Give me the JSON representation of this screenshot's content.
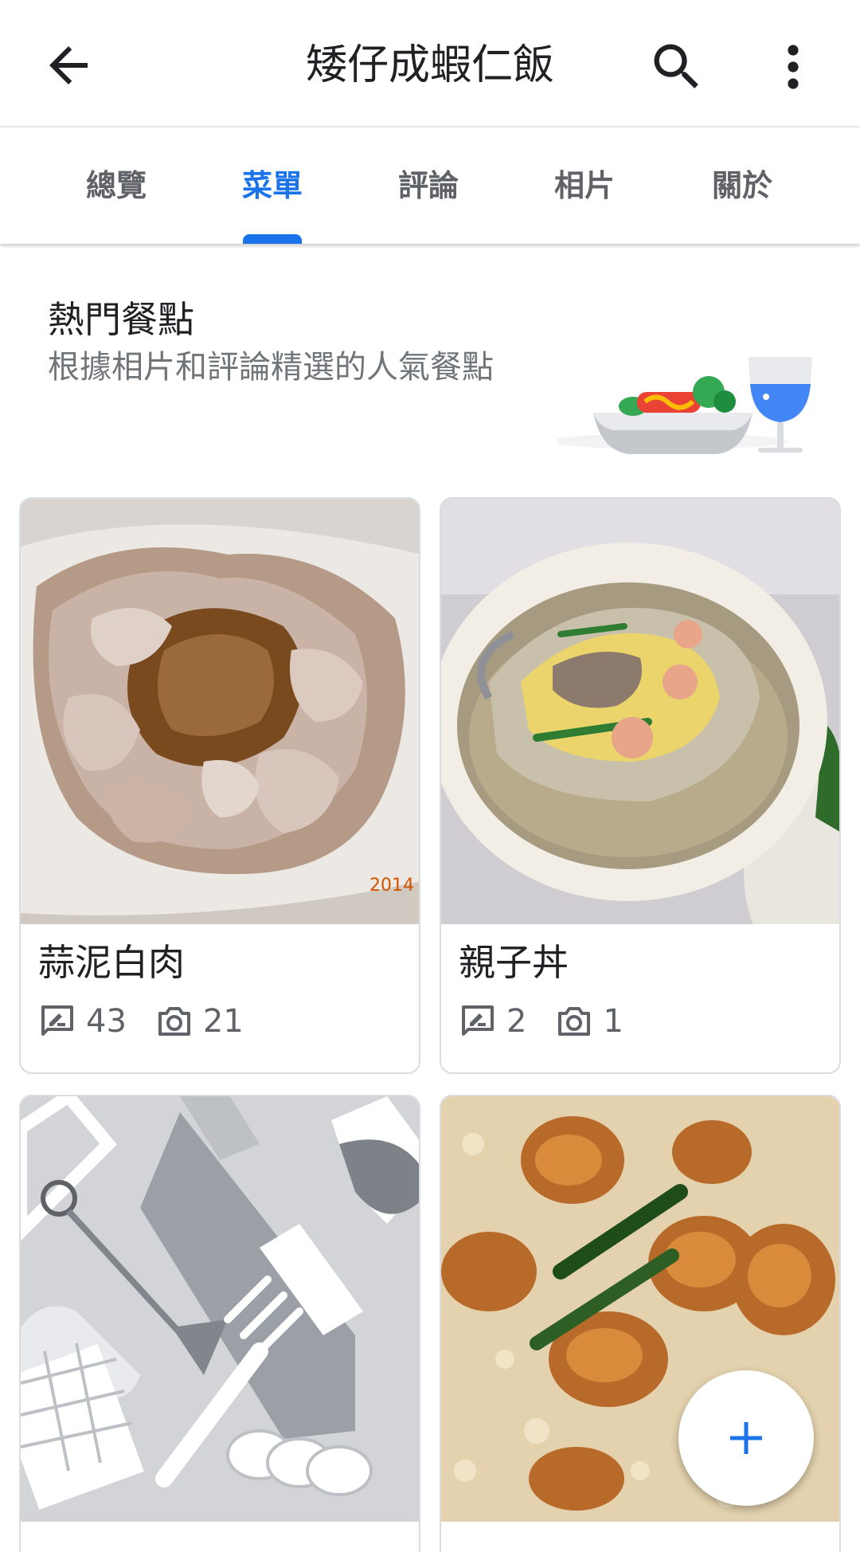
{
  "appbar": {
    "title": "矮仔成蝦仁飯",
    "icons": {
      "back": "arrow-back-icon",
      "search": "search-icon",
      "more": "more-vert-icon"
    }
  },
  "tabs": [
    {
      "label": "總覽",
      "active": false
    },
    {
      "label": "菜單",
      "active": true
    },
    {
      "label": "評論",
      "active": false
    },
    {
      "label": "相片",
      "active": false
    },
    {
      "label": "關於",
      "active": false
    }
  ],
  "section": {
    "title": "熱門餐點",
    "subtitle": "根據相片和評論精選的人氣餐點"
  },
  "dishes": [
    {
      "name": "蒜泥白肉",
      "reviews": "43",
      "photos": "21",
      "photo_text": "2014"
    },
    {
      "name": "親子丼",
      "reviews": "2",
      "photos": "1"
    },
    {
      "name": "",
      "placeholder": true
    },
    {
      "name": ""
    }
  ],
  "fab": {
    "icon": "plus-icon"
  },
  "colors": {
    "accent": "#1a73e8",
    "text": "#202124",
    "secondary": "#5f6368"
  }
}
